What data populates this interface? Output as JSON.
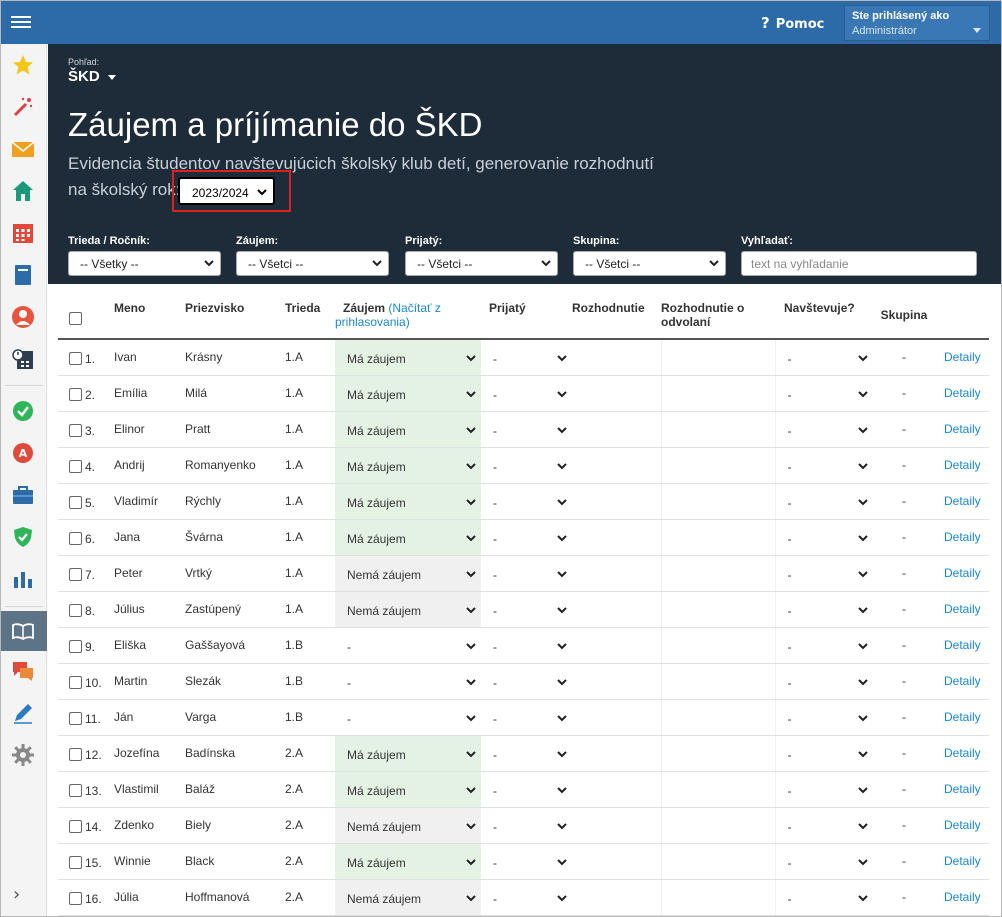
{
  "topbar": {
    "help_label": "Pomoc",
    "user_label": "Ste prihlásený ako",
    "user_role": "Administrátor"
  },
  "colors": {
    "topbar": "#2d6aa8",
    "header": "#1e2b38",
    "link": "#1e86d0",
    "interest_bg": "#e4f2e4",
    "highlight_border": "#e02020"
  },
  "sidebar_icons": [
    "star-icon",
    "magic-wand-icon",
    "mail-icon",
    "home-icon",
    "calendar-icon",
    "book-icon",
    "user-icon",
    "schedule-icon",
    "check-circle-icon",
    "grade-icon",
    "briefcase-icon",
    "shield-check-icon",
    "bar-chart-icon",
    "open-book-icon",
    "chat-icon",
    "pen-icon",
    "gear-icon",
    "expand-icon"
  ],
  "header": {
    "view_label": "Pohľad:",
    "view_name": "ŠKD",
    "title": "Záujem a príjímanie do ŠKD",
    "subtitle": "Evidencia študentov navštevujúcich školský klub detí, generovanie rozhodnutí",
    "year_label": "na školský rok:",
    "year_value": "2023/2024"
  },
  "filters": {
    "class_label": "Trieda / Ročník:",
    "class_value": "-- Všetky --",
    "interest_label": "Záujem:",
    "interest_value": "-- Všetci --",
    "accepted_label": "Prijatý:",
    "accepted_value": "-- Všetci --",
    "group_label": "Skupina:",
    "group_value": "-- Všetci --",
    "search_label": "Vyhľadať:",
    "search_placeholder": "text na vyhľadanie"
  },
  "table": {
    "headers": {
      "name": "Meno",
      "surname": "Priezvisko",
      "class": "Trieda",
      "interest": "Záujem",
      "interest_link": "(Načítať z prihlasovania)",
      "accepted": "Prijatý",
      "decision": "Rozhodnutie",
      "appeal": "Rozhodnutie o odvolaní",
      "attends": "Navštevuje?",
      "group": "Skupina"
    },
    "detail_label": "Detaily",
    "rows": [
      {
        "num": "1.",
        "name": "Ivan",
        "surname": "Krásny",
        "cls": "1.A",
        "interest": "Má záujem",
        "accepted": "-",
        "attends": "-",
        "group": "-",
        "kind": "g"
      },
      {
        "num": "2.",
        "name": "Emília",
        "surname": "Milá",
        "cls": "1.A",
        "interest": "Má záujem",
        "accepted": "-",
        "attends": "-",
        "group": "-",
        "kind": "g"
      },
      {
        "num": "3.",
        "name": "Elinor",
        "surname": "Pratt",
        "cls": "1.A",
        "interest": "Má záujem",
        "accepted": "-",
        "attends": "-",
        "group": "-",
        "kind": "g"
      },
      {
        "num": "4.",
        "name": "Andrij",
        "surname": "Romanyenko",
        "cls": "1.A",
        "interest": "Má záujem",
        "accepted": "-",
        "attends": "-",
        "group": "-",
        "kind": "g"
      },
      {
        "num": "5.",
        "name": "Vladimír",
        "surname": "Rýchly",
        "cls": "1.A",
        "interest": "Má záujem",
        "accepted": "-",
        "attends": "-",
        "group": "-",
        "kind": "g"
      },
      {
        "num": "6.",
        "name": "Jana",
        "surname": "Švárna",
        "cls": "1.A",
        "interest": "Má záujem",
        "accepted": "-",
        "attends": "-",
        "group": "-",
        "kind": "g"
      },
      {
        "num": "7.",
        "name": "Peter",
        "surname": "Vrtký",
        "cls": "1.A",
        "interest": "Nemá záujem",
        "accepted": "-",
        "attends": "-",
        "group": "-",
        "kind": "n"
      },
      {
        "num": "8.",
        "name": "Július",
        "surname": "Zastúpený",
        "cls": "1.A",
        "interest": "Nemá záujem",
        "accepted": "-",
        "attends": "-",
        "group": "-",
        "kind": "n"
      },
      {
        "num": "9.",
        "name": "Eliška",
        "surname": "Gaššayová",
        "cls": "1.B",
        "interest": "-",
        "accepted": "-",
        "attends": "-",
        "group": "-",
        "kind": "d"
      },
      {
        "num": "10.",
        "name": "Martin",
        "surname": "Slezák",
        "cls": "1.B",
        "interest": "-",
        "accepted": "-",
        "attends": "-",
        "group": "-",
        "kind": "d"
      },
      {
        "num": "11.",
        "name": "Ján",
        "surname": "Varga",
        "cls": "1.B",
        "interest": "-",
        "accepted": "-",
        "attends": "-",
        "group": "-",
        "kind": "d"
      },
      {
        "num": "12.",
        "name": "Jozefína",
        "surname": "Badínska",
        "cls": "2.A",
        "interest": "Má záujem",
        "accepted": "-",
        "attends": "-",
        "group": "-",
        "kind": "g"
      },
      {
        "num": "13.",
        "name": "Vlastimil",
        "surname": "Baláž",
        "cls": "2.A",
        "interest": "Má záujem",
        "accepted": "-",
        "attends": "-",
        "group": "-",
        "kind": "g"
      },
      {
        "num": "14.",
        "name": "Zdenko",
        "surname": "Biely",
        "cls": "2.A",
        "interest": "Nemá záujem",
        "accepted": "-",
        "attends": "-",
        "group": "-",
        "kind": "n"
      },
      {
        "num": "15.",
        "name": "Winnie",
        "surname": "Black",
        "cls": "2.A",
        "interest": "Má záujem",
        "accepted": "-",
        "attends": "-",
        "group": "-",
        "kind": "g"
      },
      {
        "num": "16.",
        "name": "Júlia",
        "surname": "Hoffmanová",
        "cls": "2.A",
        "interest": "Nemá záujem",
        "accepted": "-",
        "attends": "-",
        "group": "-",
        "kind": "n"
      }
    ]
  }
}
